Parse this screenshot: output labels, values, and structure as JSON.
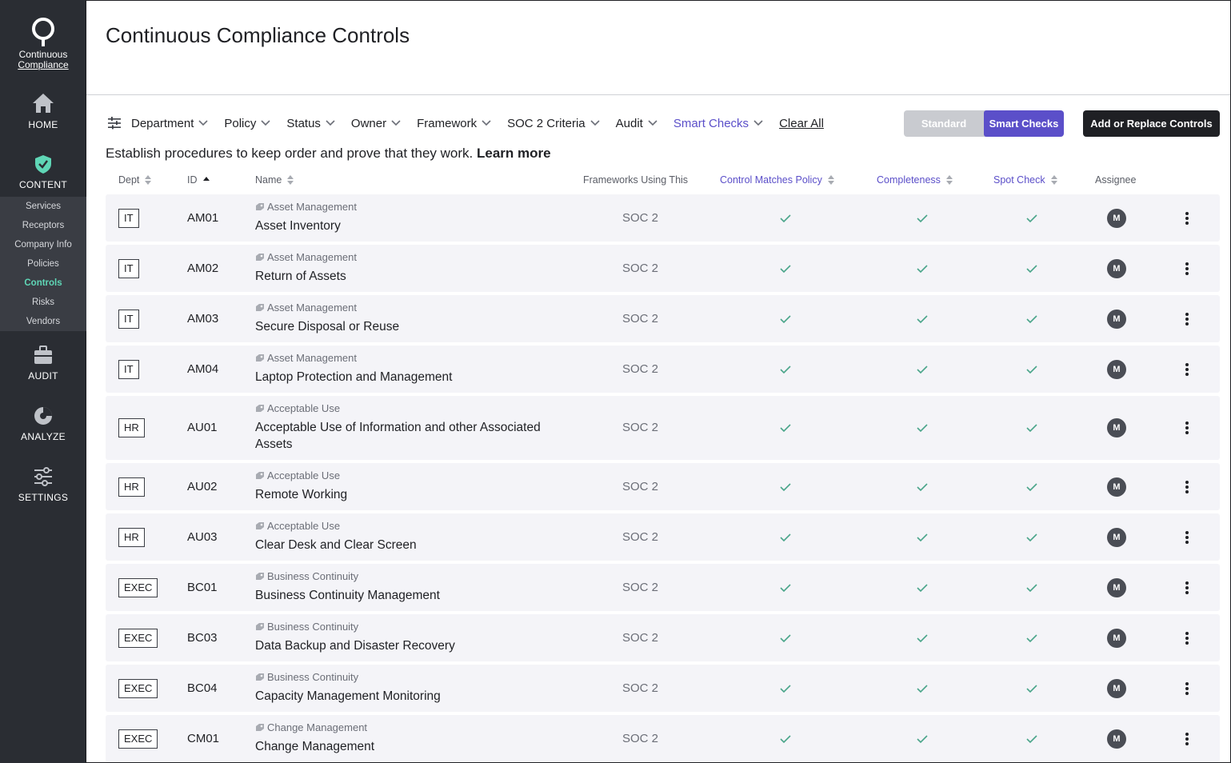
{
  "sidebar": {
    "logo_line1": "Continuous",
    "logo_line2": "Compliance",
    "home": "HOME",
    "content": "CONTENT",
    "subitems": [
      "Services",
      "Receptors",
      "Company Info",
      "Policies",
      "Controls",
      "Risks",
      "Vendors"
    ],
    "active_subitem": "Controls",
    "audit": "AUDIT",
    "analyze": "ANALYZE",
    "settings": "SETTINGS",
    "accent_color": "#5fd6b6"
  },
  "page": {
    "title": "Continuous Compliance Controls",
    "description": "Establish procedures to keep order and prove that they work.",
    "learn_more": "Learn more"
  },
  "filters": {
    "items": [
      "Department",
      "Policy",
      "Status",
      "Owner",
      "Framework",
      "SOC 2 Criteria",
      "Audit"
    ],
    "smart_checks": "Smart Checks",
    "clear_all": "Clear All"
  },
  "toggle": {
    "standard": "Standard",
    "smart_checks": "Smart Checks",
    "selected": "Smart Checks",
    "accent_color": "#5b4fc9"
  },
  "add_button": "Add or Replace Controls",
  "columns": {
    "dept": "Dept",
    "id": "ID",
    "name": "Name",
    "frameworks": "Frameworks Using This",
    "control_matches_policy": "Control Matches Policy",
    "completeness": "Completeness",
    "spot_check": "Spot Check",
    "assignee": "Assignee"
  },
  "rows": [
    {
      "dept": "IT",
      "id": "AM01",
      "category": "Asset Management",
      "name": "Asset Inventory",
      "framework": "SOC 2",
      "assignee": "M"
    },
    {
      "dept": "IT",
      "id": "AM02",
      "category": "Asset Management",
      "name": "Return of Assets",
      "framework": "SOC 2",
      "assignee": "M"
    },
    {
      "dept": "IT",
      "id": "AM03",
      "category": "Asset Management",
      "name": "Secure Disposal or Reuse",
      "framework": "SOC 2",
      "assignee": "M"
    },
    {
      "dept": "IT",
      "id": "AM04",
      "category": "Asset Management",
      "name": "Laptop Protection and Management",
      "framework": "SOC 2",
      "assignee": "M"
    },
    {
      "dept": "HR",
      "id": "AU01",
      "category": "Acceptable Use",
      "name": "Acceptable Use of Information and other Associated Assets",
      "framework": "SOC 2",
      "assignee": "M"
    },
    {
      "dept": "HR",
      "id": "AU02",
      "category": "Acceptable Use",
      "name": "Remote Working",
      "framework": "SOC 2",
      "assignee": "M"
    },
    {
      "dept": "HR",
      "id": "AU03",
      "category": "Acceptable Use",
      "name": "Clear Desk and Clear Screen",
      "framework": "SOC 2",
      "assignee": "M"
    },
    {
      "dept": "EXEC",
      "id": "BC01",
      "category": "Business Continuity",
      "name": "Business Continuity Management",
      "framework": "SOC 2",
      "assignee": "M"
    },
    {
      "dept": "EXEC",
      "id": "BC03",
      "category": "Business Continuity",
      "name": "Data Backup and Disaster Recovery",
      "framework": "SOC 2",
      "assignee": "M"
    },
    {
      "dept": "EXEC",
      "id": "BC04",
      "category": "Business Continuity",
      "name": "Capacity Management Monitoring",
      "framework": "SOC 2",
      "assignee": "M"
    },
    {
      "dept": "EXEC",
      "id": "CM01",
      "category": "Change Management",
      "name": "Change Management",
      "framework": "SOC 2",
      "assignee": "M"
    }
  ],
  "check_color": "#4aa58a"
}
